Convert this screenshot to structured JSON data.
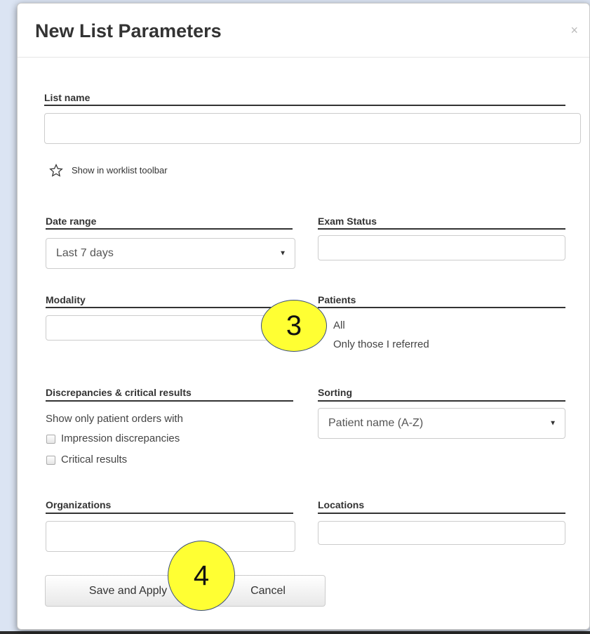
{
  "dialog": {
    "title": "New List Parameters",
    "close_glyph": "×"
  },
  "list_name": {
    "label": "List name",
    "value": "",
    "placeholder": ""
  },
  "toolbar_option": {
    "icon": "star-outline-icon",
    "label": "Show in worklist toolbar"
  },
  "date_range": {
    "label": "Date range",
    "selected": "Last 7 days"
  },
  "exam_status": {
    "label": "Exam Status",
    "value": ""
  },
  "modality": {
    "label": "Modality",
    "value": ""
  },
  "patients": {
    "label": "Patients",
    "options": [
      "All",
      "Only those I referred"
    ]
  },
  "discrepancies": {
    "label": "Discrepancies & critical results",
    "description": "Show only patient orders with",
    "options": [
      "Impression discrepancies",
      "Critical results"
    ]
  },
  "sorting": {
    "label": "Sorting",
    "selected": "Patient name (A-Z)"
  },
  "organizations": {
    "label": "Organizations",
    "value": ""
  },
  "locations": {
    "label": "Locations",
    "value": ""
  },
  "buttons": {
    "save": "Save and Apply",
    "cancel": "Cancel"
  },
  "callouts": [
    "3",
    "4"
  ],
  "colors": {
    "callout_fill": "#ffff33",
    "callout_border": "#3b4e7a",
    "backdrop": "#dbe4f3"
  }
}
